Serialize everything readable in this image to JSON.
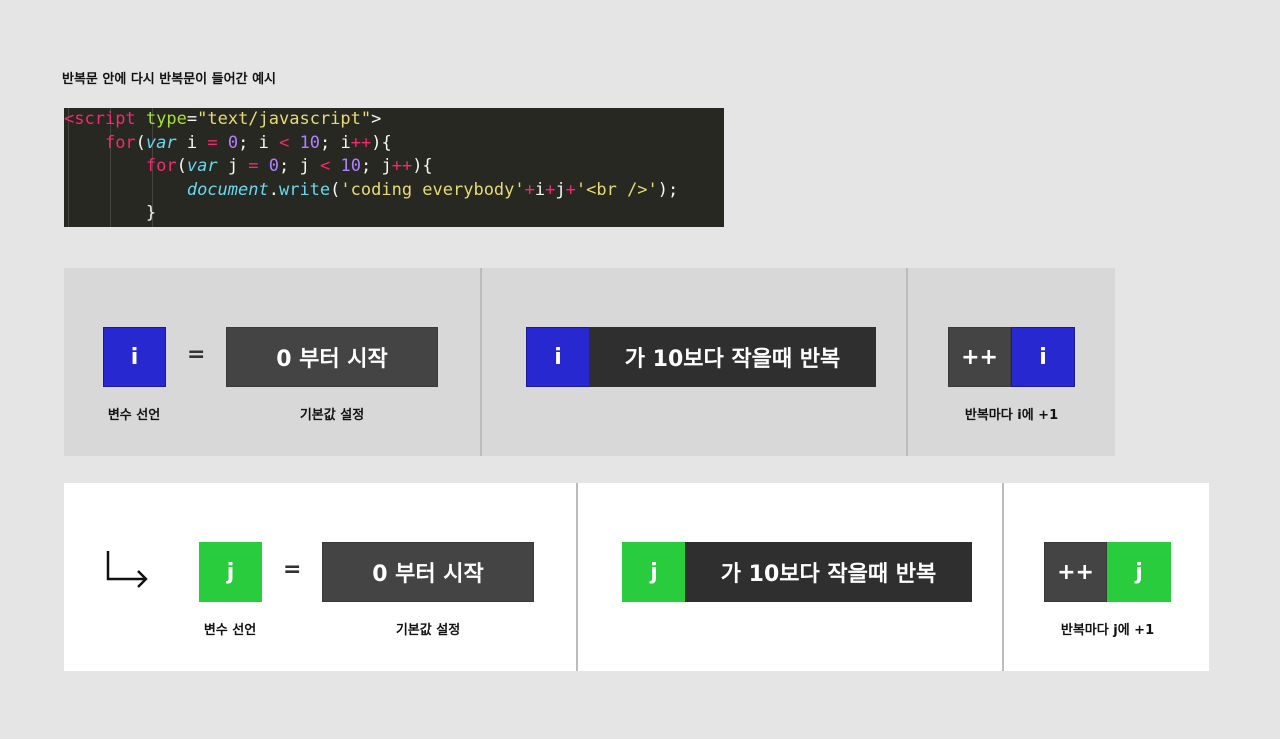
{
  "heading": "반복문 안에 다시 반복문이 들어간 예시",
  "code": {
    "line1": {
      "lt": "<",
      "tag": "script",
      "attr": "type",
      "eq": "=",
      "value": "\"text/javascript\"",
      "gt": ">"
    },
    "line2": {
      "kw": "for",
      "open": "(",
      "type": "var",
      "var": " i ",
      "op1": "=",
      "sp1": " ",
      "num0": "0",
      "semi1": "; i ",
      "lt": "<",
      "sp2": " ",
      "num10": "10",
      "semi2": "; i",
      "inc": "++",
      "close": "){"
    },
    "line3": {
      "kw": "for",
      "open": "(",
      "type": "var",
      "var": " j ",
      "op1": "=",
      "sp1": " ",
      "num0": "0",
      "semi1": "; j ",
      "lt": "<",
      "sp2": " ",
      "num10": "10",
      "semi2": "; j",
      "inc": "++",
      "close": "){"
    },
    "line4": {
      "obj": "document",
      "dot": ".",
      "fn": "write",
      "open": "(",
      "str1": "'coding everybody'",
      "plus1": "+",
      "i": "i",
      "plus2": "+",
      "j": "j",
      "plus3": "+",
      "str2": "'<br />'",
      "close": ");"
    },
    "line5": {
      "brace": "}"
    }
  },
  "outer_loop": {
    "var_box": "i",
    "equals": "=",
    "init_box": "0 부터 시작",
    "var_caption": "변수 선언",
    "init_caption": "기본값 설정",
    "cond_var": "i",
    "cond_box": "가 10보다 작을때 반복",
    "inc_op": "++",
    "inc_var": "i",
    "inc_caption": "반복마다 i에 +1"
  },
  "inner_loop": {
    "arrow_icon": "return-arrow-icon",
    "var_box": "j",
    "equals": "=",
    "init_box": "0 부터 시작",
    "var_caption": "변수 선언",
    "init_caption": "기본값 설정",
    "cond_var": "j",
    "cond_box": "가 10보다 작을때 반복",
    "inc_op": "++",
    "inc_var": "j",
    "inc_caption": "반복마다 j에 +1"
  },
  "colors": {
    "outer_var": "#2828d0",
    "inner_var": "#29cc3c",
    "box_dark": "#444444",
    "code_bg": "#272822"
  }
}
